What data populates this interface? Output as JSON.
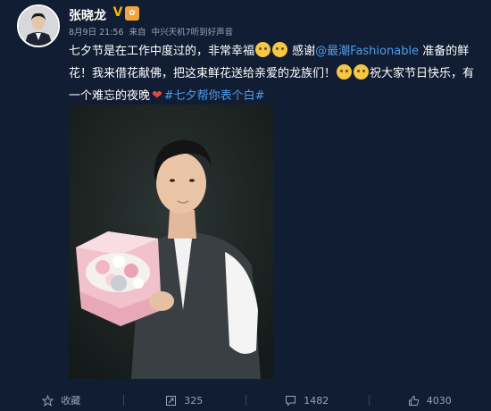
{
  "user": {
    "name": "张晓龙",
    "verified_icon": "verified-v-icon",
    "level_icon": "level-badge-icon"
  },
  "meta": {
    "date": "8月9日 21:56",
    "from": "来自",
    "source": "中兴天机7听到好声音"
  },
  "post": {
    "text_1": "七夕节是在工作中度过的，非常幸福",
    "text_2": " 感谢",
    "mention": "@最潮Fashionable",
    "text_3": " 准备的鲜花！我来借花献佛，把这束鲜花送给亲爱的龙族们！",
    "text_4": "祝大家节日快乐，有一个难忘的夜晚",
    "hashtag": "#七夕帮你表个白#"
  },
  "actions": {
    "favorite_label": "收藏",
    "repost_count": "325",
    "comment_count": "1482",
    "like_count": "4030"
  },
  "colors": {
    "background": "#111d33",
    "link": "#4e9cf0",
    "meta": "#9aa3b5"
  }
}
